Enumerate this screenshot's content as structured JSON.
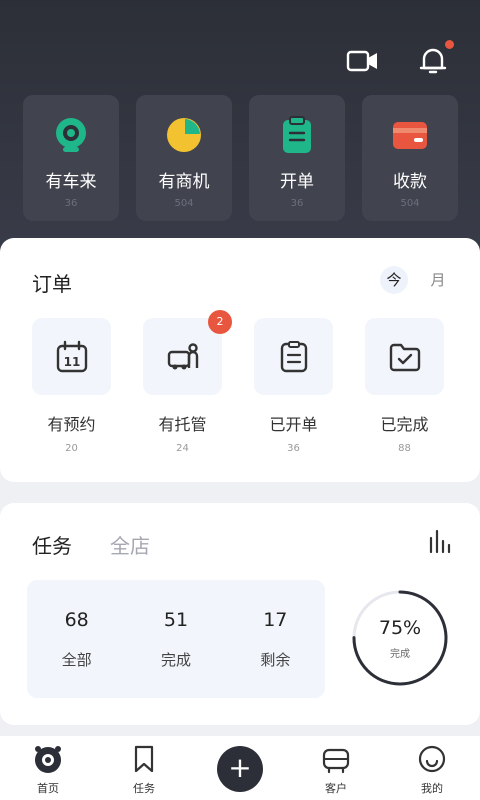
{
  "quick_actions": [
    {
      "label": "有车来",
      "count": "36",
      "icon": "camera-icon",
      "color": "#1fb68a"
    },
    {
      "label": "有商机",
      "count": "504",
      "icon": "pie-chart-icon",
      "color": "#f2c230"
    },
    {
      "label": "开单",
      "count": "36",
      "icon": "clipboard-icon",
      "color": "#1fb68a"
    },
    {
      "label": "收款",
      "count": "504",
      "icon": "wallet-icon",
      "color": "#e9563f"
    }
  ],
  "order": {
    "title": "订单",
    "period_today": "今",
    "period_month": "月",
    "items": [
      {
        "label": "有预约",
        "count": "20",
        "icon": "calendar-icon"
      },
      {
        "label": "有托管",
        "count": "24",
        "icon": "car-service-icon",
        "badge": "2"
      },
      {
        "label": "已开单",
        "count": "36",
        "icon": "document-icon"
      },
      {
        "label": "已完成",
        "count": "88",
        "icon": "folder-check-icon"
      }
    ]
  },
  "task": {
    "tab_active": "任务",
    "tab_inactive": "全店",
    "stats": [
      {
        "value": "68",
        "label": "全部"
      },
      {
        "value": "51",
        "label": "完成"
      },
      {
        "value": "17",
        "label": "剩余"
      }
    ],
    "progress_percent": "75%",
    "progress_value": 0.75,
    "progress_label": "完成"
  },
  "tabbar": [
    {
      "label": "首页",
      "icon": "home-camera-icon"
    },
    {
      "label": "任务",
      "icon": "bookmark-icon"
    },
    {
      "label": "",
      "icon": "plus-icon"
    },
    {
      "label": "客户",
      "icon": "car-icon"
    },
    {
      "label": "我的",
      "icon": "smiley-icon"
    }
  ],
  "colors": {
    "header_bg": "#2c2f37",
    "accent_red": "#e9563f",
    "accent_green": "#1fb68a",
    "accent_yellow": "#f2c230"
  }
}
